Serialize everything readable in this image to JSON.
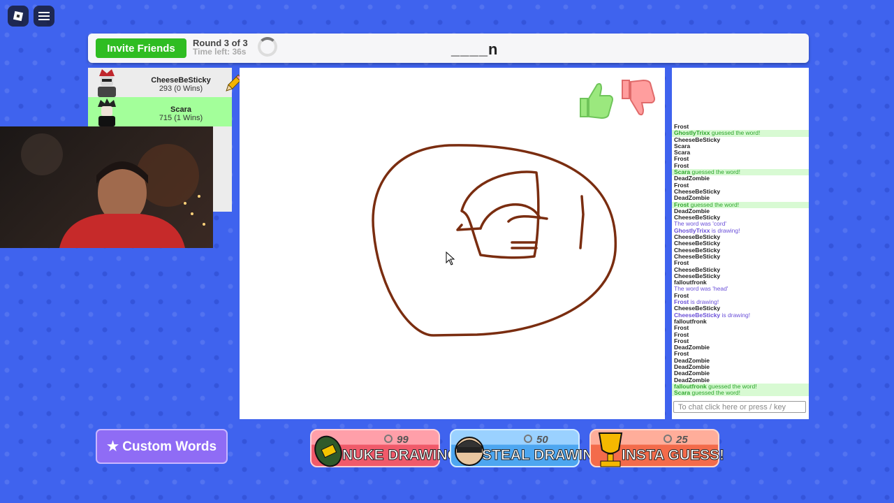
{
  "top": {
    "invite_label": "Invite Friends",
    "round": "Round 3 of 3",
    "time_left": "Time left: 36s",
    "word_hint": "____n"
  },
  "players": [
    {
      "name": "CheeseBeSticky",
      "score": "293 (0 Wins)",
      "highlight": false
    },
    {
      "name": "Scara",
      "score": "715 (1 Wins)",
      "highlight": true
    }
  ],
  "chat": {
    "lines": [
      {
        "who": "Frost",
        "msg": "",
        "kind": "normal"
      },
      {
        "who": "GhostlyTrixx",
        "msg": " guessed the word!",
        "kind": "guess"
      },
      {
        "who": "CheeseBeSticky",
        "msg": "",
        "kind": "normal"
      },
      {
        "who": "Scara",
        "msg": "",
        "kind": "normal"
      },
      {
        "who": "Scara",
        "msg": "",
        "kind": "normal"
      },
      {
        "who": "Frost",
        "msg": "",
        "kind": "normal"
      },
      {
        "who": "Frost",
        "msg": "",
        "kind": "normal"
      },
      {
        "who": "Scara",
        "msg": " guessed the word!",
        "kind": "guess"
      },
      {
        "who": "DeadZombie",
        "msg": "",
        "kind": "normal"
      },
      {
        "who": "Frost",
        "msg": "",
        "kind": "normal"
      },
      {
        "who": "CheeseBeSticky",
        "msg": "",
        "kind": "normal"
      },
      {
        "who": "DeadZombie",
        "msg": "",
        "kind": "normal"
      },
      {
        "who": "Frost",
        "msg": " guessed the word!",
        "kind": "guess"
      },
      {
        "who": "DeadZombie",
        "msg": "",
        "kind": "normal"
      },
      {
        "who": "CheeseBeSticky",
        "msg": "",
        "kind": "normal"
      },
      {
        "who": "",
        "msg": " The word was 'cord'",
        "kind": "purple"
      },
      {
        "who": "GhostlyTrixx",
        "msg": " is drawing!",
        "kind": "purple"
      },
      {
        "who": "CheeseBeSticky",
        "msg": "",
        "kind": "normal"
      },
      {
        "who": "CheeseBeSticky",
        "msg": "",
        "kind": "normal"
      },
      {
        "who": "CheeseBeSticky",
        "msg": "",
        "kind": "normal"
      },
      {
        "who": "CheeseBeSticky",
        "msg": "",
        "kind": "normal"
      },
      {
        "who": "Frost",
        "msg": "",
        "kind": "normal"
      },
      {
        "who": "CheeseBeSticky",
        "msg": "",
        "kind": "normal"
      },
      {
        "who": "CheeseBeSticky",
        "msg": "",
        "kind": "normal"
      },
      {
        "who": "falloutfronk",
        "msg": "",
        "kind": "normal"
      },
      {
        "who": "",
        "msg": " The word was 'head'",
        "kind": "purple"
      },
      {
        "who": "Frost",
        "msg": "",
        "kind": "normal"
      },
      {
        "who": "Frost",
        "msg": " is drawing!",
        "kind": "purple"
      },
      {
        "who": "CheeseBeSticky",
        "msg": "",
        "kind": "normal"
      },
      {
        "who": "CheeseBeSticky",
        "msg": " is drawing!",
        "kind": "purple"
      },
      {
        "who": "falloutfronk",
        "msg": "",
        "kind": "normal"
      },
      {
        "who": "Frost",
        "msg": "",
        "kind": "normal"
      },
      {
        "who": "Frost",
        "msg": "",
        "kind": "normal"
      },
      {
        "who": "Frost",
        "msg": "",
        "kind": "normal"
      },
      {
        "who": "DeadZombie",
        "msg": "",
        "kind": "normal"
      },
      {
        "who": "Frost",
        "msg": "",
        "kind": "normal"
      },
      {
        "who": "DeadZombie",
        "msg": "",
        "kind": "normal"
      },
      {
        "who": "DeadZombie",
        "msg": "",
        "kind": "normal"
      },
      {
        "who": "DeadZombie",
        "msg": "",
        "kind": "normal"
      },
      {
        "who": "DeadZombie",
        "msg": "",
        "kind": "normal"
      },
      {
        "who": "falloutfronk",
        "msg": " guessed the word!",
        "kind": "guess"
      },
      {
        "who": "Scara",
        "msg": " guessed the word!",
        "kind": "guess"
      }
    ],
    "placeholder": "To chat click here or press / key"
  },
  "bottom": {
    "custom_words": "★ Custom Words",
    "powers": [
      {
        "id": "nuke",
        "cost": "99",
        "label": "NUKE DRAWING!"
      },
      {
        "id": "steal",
        "cost": "50",
        "label": "STEAL DRAWING!"
      },
      {
        "id": "insta",
        "cost": "25",
        "label": "INSTA GUESS!"
      }
    ]
  },
  "colors": {
    "stroke": "#7a2d10",
    "invite": "#2fbd22",
    "guess_bg": "#d8fad3",
    "purple": "#6a4fd8"
  },
  "icons": [
    "roblox-logo-icon",
    "hamburger-menu-icon",
    "pencil-icon",
    "thumbs-up-icon",
    "thumbs-down-icon",
    "bomb-icon",
    "robber-icon",
    "trophy-icon",
    "coin-icon",
    "mouse-cursor-icon"
  ]
}
